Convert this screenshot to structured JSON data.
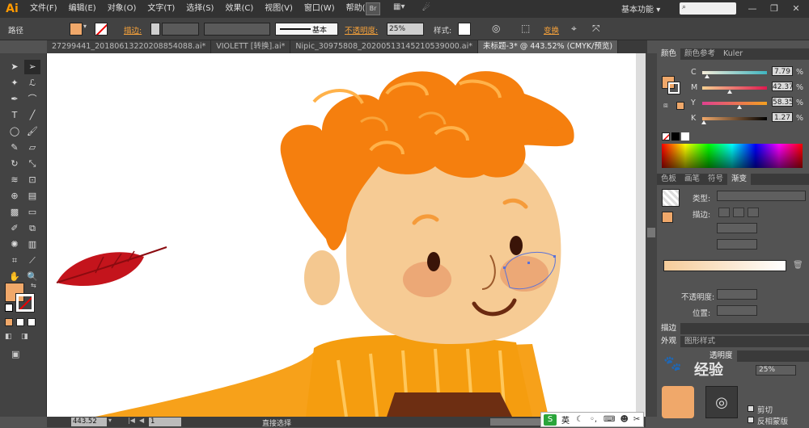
{
  "app": {
    "logo": "Ai",
    "workspace": "基本功能",
    "workspace_arrow": "▾"
  },
  "menu": [
    "文件(F)",
    "编辑(E)",
    "对象(O)",
    "文字(T)",
    "选择(S)",
    "效果(C)",
    "视图(V)",
    "窗口(W)",
    "帮助(H)"
  ],
  "control_bar": {
    "object_type": "路径",
    "stroke_label": "描边:",
    "stroke_style": "基本",
    "opacity_label": "不透明度:",
    "opacity_value": "25%",
    "style_label": "样式:",
    "transform_label": "变换",
    "fill_color": "#f0a86a"
  },
  "tabs": [
    {
      "label": "27299441_20180613220208854088.ai*",
      "active": false
    },
    {
      "label": "VIOLETT [转换].ai*",
      "active": false
    },
    {
      "label": "Nipic_30975808_20200513145210539000.ai*",
      "active": false
    },
    {
      "label": "未标题-3* @ 443.52% (CMYK/预览)",
      "active": true
    }
  ],
  "color_panel": {
    "tabs": [
      "颜色",
      "颜色参考",
      "Kuler"
    ],
    "channels": [
      {
        "label": "C",
        "value": "7.79",
        "unit": "%",
        "pos": 0.08
      },
      {
        "label": "M",
        "value": "42.37",
        "unit": "%",
        "pos": 0.42
      },
      {
        "label": "Y",
        "value": "58.35",
        "unit": "%",
        "pos": 0.58
      },
      {
        "label": "K",
        "value": "1.27",
        "unit": "%",
        "pos": 0.02
      }
    ]
  },
  "gradient_panel": {
    "tabs": [
      "色板",
      "画笔",
      "符号",
      "渐变"
    ],
    "type_label": "类型:",
    "stroke_label": "描边:",
    "opacity_label": "不透明度:",
    "position_label": "位置:"
  },
  "stroke_panel": {
    "title": "描边"
  },
  "appearance_panel": {
    "tabs": [
      "外观",
      "图形样式"
    ],
    "transparency_label": "透明度",
    "value_partial": "25%",
    "clip_label": "剪切",
    "invert_label": "反相蒙版"
  },
  "status_bar": {
    "zoom": "443.52",
    "page": "1",
    "tool": "直接选择"
  },
  "ime": {
    "lang": "英"
  },
  "watermark": "经验"
}
